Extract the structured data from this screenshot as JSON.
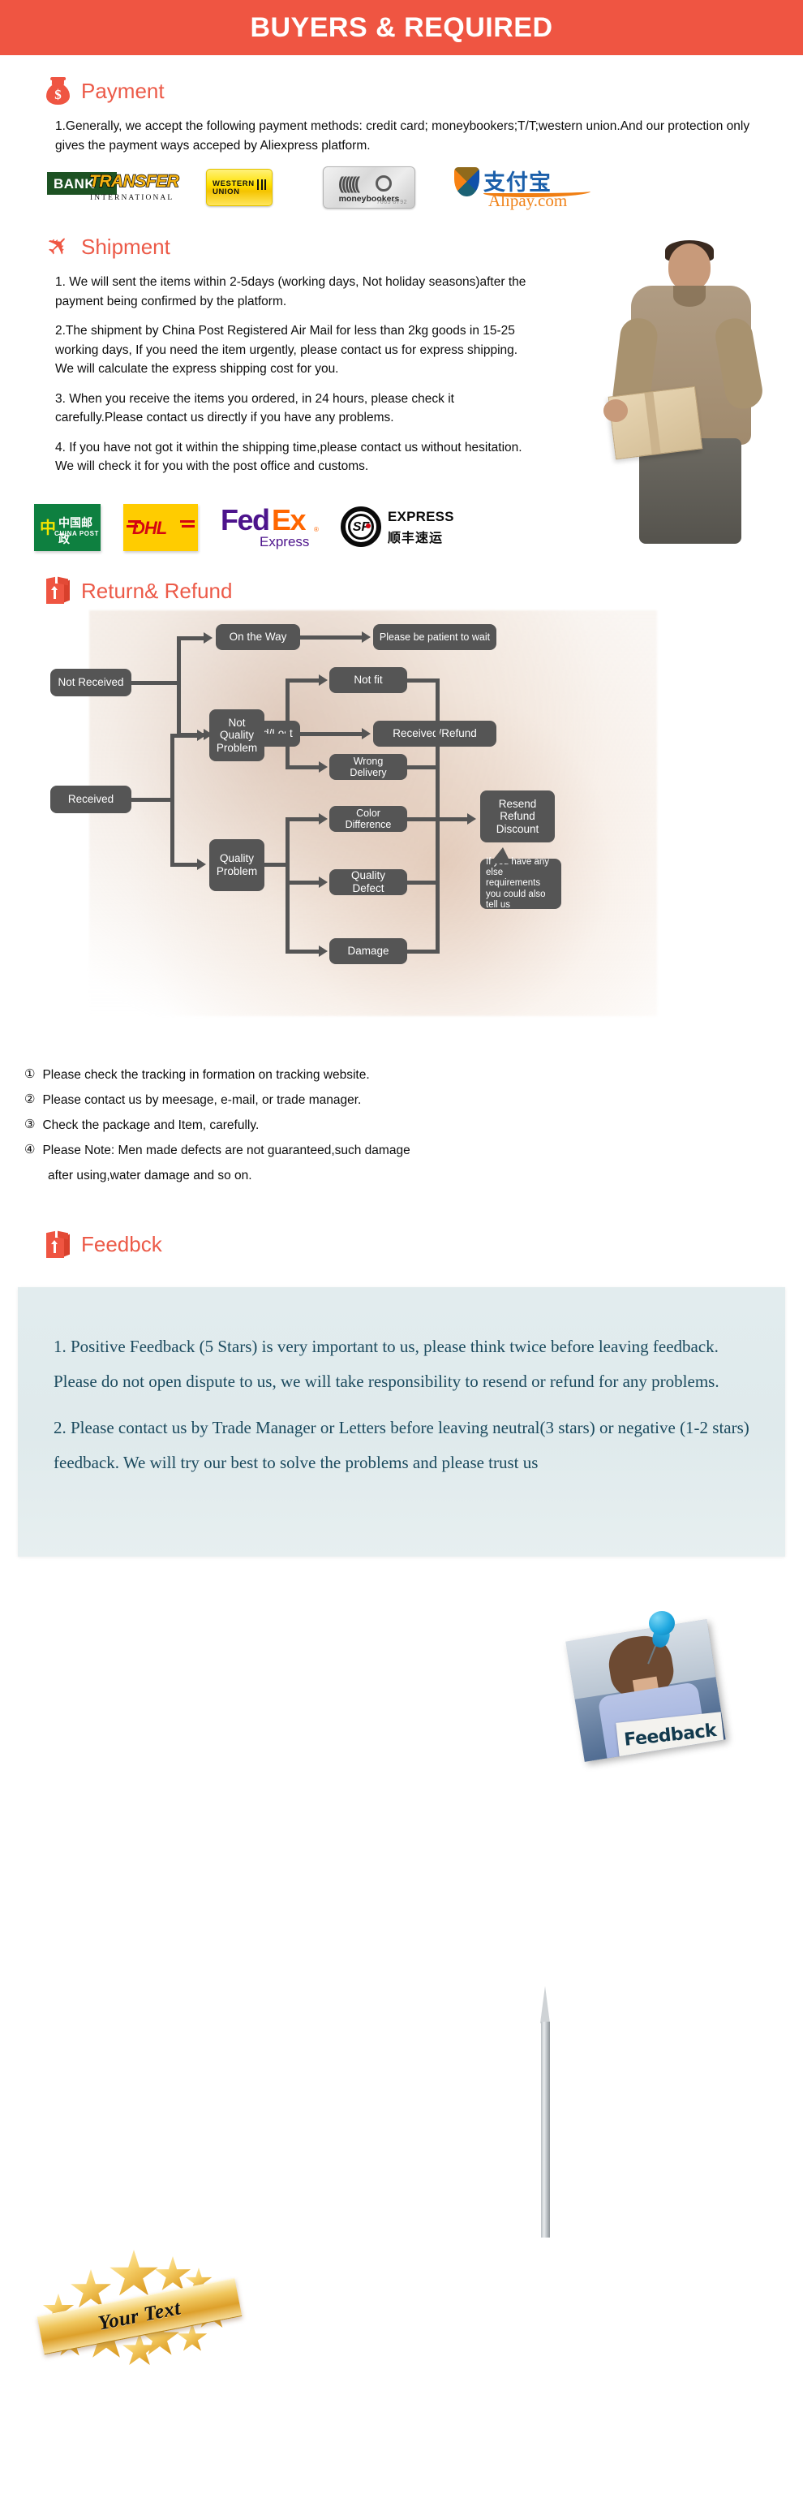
{
  "header": {
    "title": "BUYERS & REQUIRED"
  },
  "payment": {
    "icon": "money-bag-icon",
    "title": "Payment",
    "paragraphs": [
      "1.Generally, we accept the following payment methods: credit card; moneybookers;T/T;western union.And our protection only gives the payment ways acceped by Aliexpress platform."
    ],
    "logos": [
      {
        "name": "bank-transfer-international-logo",
        "word1": "BANK",
        "word2": "TRANSFER",
        "sub": "INTERNATIONAL"
      },
      {
        "name": "western-union-logo",
        "line1": "WESTERN",
        "line2": "UNION"
      },
      {
        "name": "moneybookers-logo",
        "label": "moneybookers",
        "number": "7665 8792"
      },
      {
        "name": "alipay-logo",
        "hanzi": "支付宝",
        "word": "Alipay.com"
      }
    ]
  },
  "shipment": {
    "icon": "airplane-icon",
    "title": "Shipment",
    "paragraphs": [
      "1. We will sent the items within 2-5days (working days, Not holiday seasons)after the payment being confirmed by the platform.",
      "2.The shipment by China Post Registered Air Mail for less than  2kg goods in 15-25 working days, If  you need the item urgently, please contact us for express shipping.\nWe will calculate the express shipping cost for you.",
      "3. When you receive the items you ordered, in 24 hours, please check it carefully.Please contact us directly if you have any problems.",
      "4. If you have not got it within the shipping time,please contact us without hesitation. We will check it for you with the post office and customs."
    ],
    "carriers": [
      {
        "name": "china-post-logo",
        "cn": "中国邮政",
        "en": "CHINA POST"
      },
      {
        "name": "dhl-logo",
        "text": "DHL"
      },
      {
        "name": "fedex-logo",
        "part1": "Fed",
        "part2": "Ex",
        "sub": "Express",
        "mark": "®"
      },
      {
        "name": "sf-express-logo",
        "mark": "SF",
        "en": "EXPRESS",
        "cn": "顺丰速运"
      }
    ]
  },
  "returns": {
    "icon": "return-box-icon",
    "title": "Return& Refund",
    "flow": {
      "not_received": "Not Received",
      "on_the_way": "On the Way",
      "please_wait": "Please be patient to wait",
      "received_lost": "Received/Lost",
      "received_refund": "Received/Refund",
      "received": "Received",
      "not_quality_problem": "Not\nQuality\nProblem",
      "quality_problem": "Quality\nProblem",
      "not_fit": "Not fit",
      "wrong_delivery": "Wrong Delivery",
      "color_difference": "Color Difference",
      "quality_defect": "Quality Defect",
      "damage": "Damage",
      "resend_refund_discount": "Resend\nRefund\nDiscount",
      "callout": "If you have any else requirements you could also tell us"
    },
    "notes": [
      {
        "num": "①",
        "text": "Please check the tracking in formation on tracking website."
      },
      {
        "num": "②",
        "text": "Please contact us by meesage, e-mail, or trade manager."
      },
      {
        "num": "③",
        "text": "Check the package and Item, carefully."
      },
      {
        "num": "④",
        "text": "Please Note: Men made defects  are not guaranteed,such damage",
        "sub": "after using,water damage and so on."
      }
    ]
  },
  "feedback": {
    "icon": "feedback-box-icon",
    "title": "Feedbck",
    "photo_card_text": "Feedback",
    "paragraphs": [
      "1. Positive Feedback (5 Stars) is very important to us, please think twice before leaving feedback. Please do not open dispute to us,   we will take responsibility to resend or refund for any problems.",
      "2. Please contact us by Trade Manager or Letters before leaving neutral(3 stars) or negative (1-2 stars) feedback. We will try our best to solve the problems and please trust us"
    ],
    "badge_text": "Your Text"
  },
  "colors": {
    "accent": "#ef5542",
    "flow_box": "#555555",
    "feedback_panel": "#e2ecee",
    "feedback_text": "#1b4a5e"
  }
}
